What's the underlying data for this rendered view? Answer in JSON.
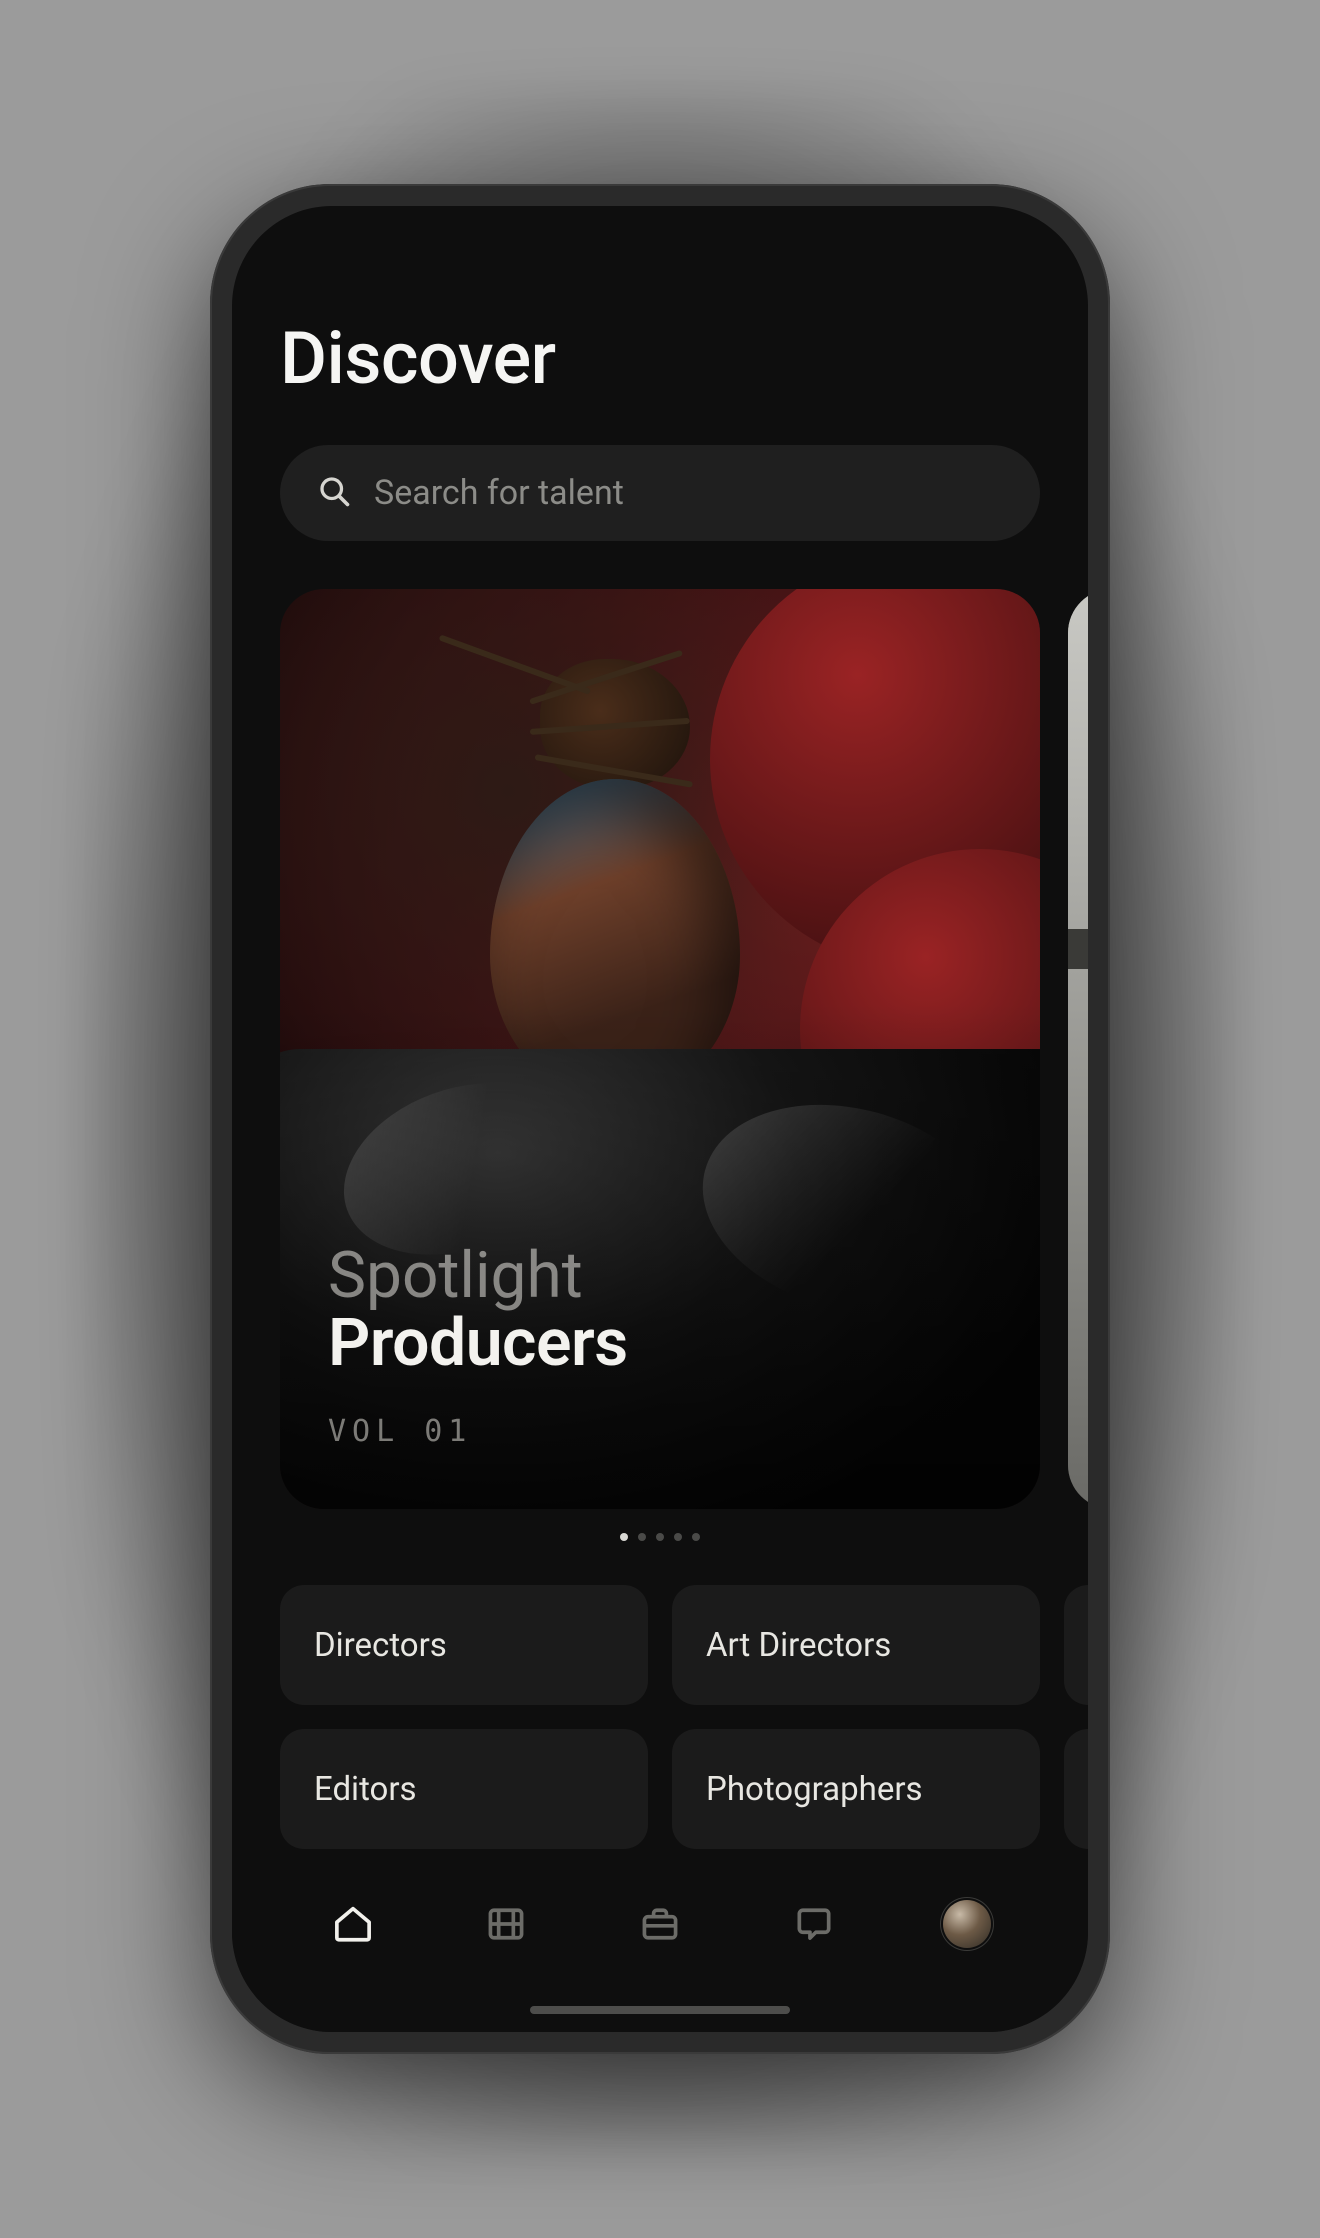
{
  "page": {
    "title": "Discover"
  },
  "search": {
    "placeholder": "Search for talent",
    "icon": "search-icon"
  },
  "spotlight": {
    "eyebrow": "Spotlight",
    "headline": "Producers",
    "volume_label": "VOL 01",
    "page_count": 5,
    "active_page_index": 0
  },
  "categories": [
    {
      "label": "Directors"
    },
    {
      "label": "Art Directors"
    },
    {
      "label": "Editors"
    },
    {
      "label": "Photographers"
    }
  ],
  "tabs": [
    {
      "name": "home",
      "icon": "home-icon",
      "active": true
    },
    {
      "name": "reels",
      "icon": "film-icon",
      "active": false
    },
    {
      "name": "jobs",
      "icon": "briefcase-icon",
      "active": false
    },
    {
      "name": "messages",
      "icon": "chat-icon",
      "active": false
    },
    {
      "name": "profile",
      "icon": "avatar",
      "active": false
    }
  ],
  "colors": {
    "background": "#0e0e0e",
    "surface": "#1b1b1b",
    "text_primary": "#f3f2ee",
    "text_muted": "#8c8c88"
  }
}
